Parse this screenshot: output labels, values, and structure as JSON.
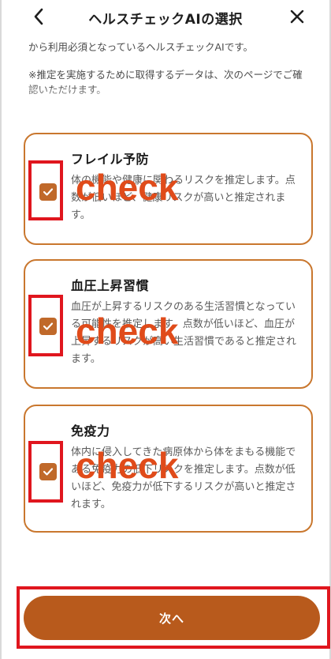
{
  "header": {
    "title": "ヘルスチェックAIの選択",
    "back_icon": "chevron-left-icon",
    "close_icon": "close-icon"
  },
  "intro": {
    "line1": "から利用必須となっているヘルスチェックAIです。",
    "line2": "※推定を実施するために取得するデータは、次のページでご確認いただけます。"
  },
  "items": [
    {
      "title": "フレイル予防",
      "description": "体の機能や健康に関わるリスクを推定します。点数が低いほど、健康リスクが高いと推定されます。",
      "checked": true,
      "annotation": "check"
    },
    {
      "title": "血圧上昇習慣",
      "description": "血圧が上昇するリスクのある生活習慣となっている可能性を推定します。点数が低いほど、血圧が上昇するリスクが高い生活習慣であると推定されます。",
      "checked": true,
      "annotation": "check"
    },
    {
      "title": "免疫力",
      "description": "体内に侵入してきた病原体から体をまもる機能である免疫力の低下リスクを推定します。点数が低いほど、免疫力が低下するリスクが高いと推定されます。",
      "checked": true,
      "annotation": "check"
    }
  ],
  "next_button": {
    "label": "次へ"
  },
  "colors": {
    "accent": "#c0692a",
    "button": "#b85a1c",
    "card_border": "#c9772e",
    "annotation_red": "#e0161e",
    "annotation_text": "#e04b1a"
  }
}
